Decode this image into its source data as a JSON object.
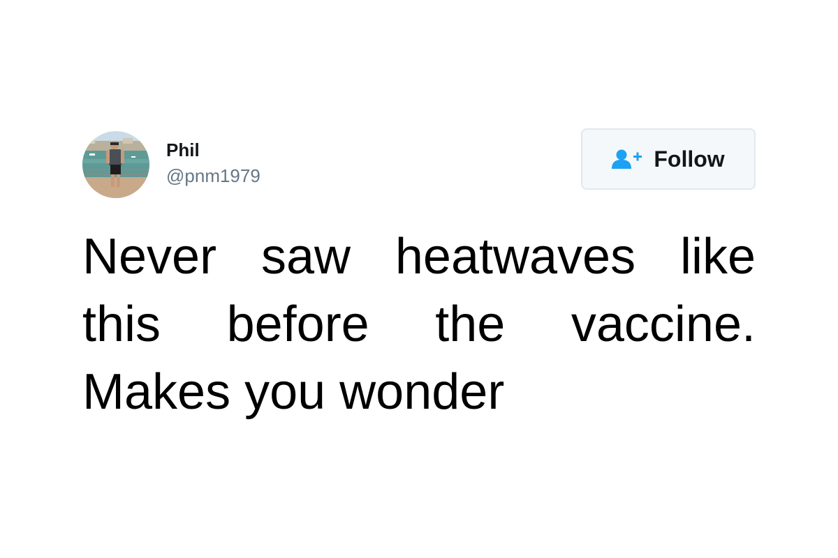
{
  "tweet": {
    "author": {
      "display_name": "Phil",
      "handle": "@pnm1979",
      "avatar_icon": "profile-photo"
    },
    "follow_button": {
      "label": "Follow",
      "icon": "add-user-icon"
    },
    "text": "Never saw heatwaves like this before the vaccine. Makes you wonder"
  },
  "colors": {
    "follow_icon": "#1da1f2",
    "handle": "#657786",
    "button_border": "#e1e8ed",
    "button_bg": "#f5f8fa"
  }
}
